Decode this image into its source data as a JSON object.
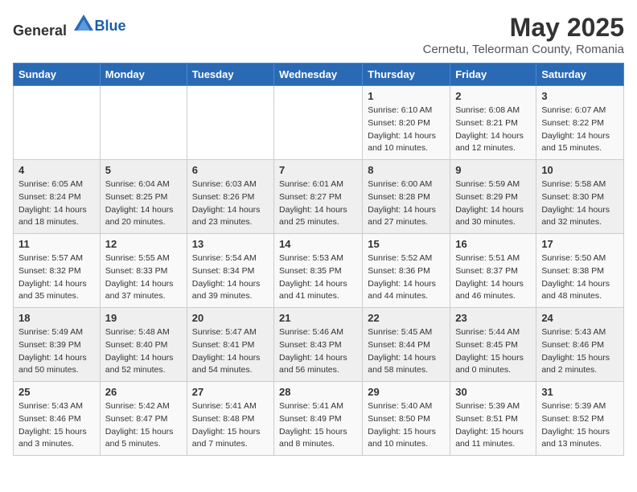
{
  "header": {
    "logo_general": "General",
    "logo_blue": "Blue",
    "month": "May 2025",
    "location": "Cernetu, Teleorman County, Romania"
  },
  "days_of_week": [
    "Sunday",
    "Monday",
    "Tuesday",
    "Wednesday",
    "Thursday",
    "Friday",
    "Saturday"
  ],
  "weeks": [
    [
      {
        "day": "",
        "info": ""
      },
      {
        "day": "",
        "info": ""
      },
      {
        "day": "",
        "info": ""
      },
      {
        "day": "",
        "info": ""
      },
      {
        "day": "1",
        "info": "Sunrise: 6:10 AM\nSunset: 8:20 PM\nDaylight: 14 hours\nand 10 minutes."
      },
      {
        "day": "2",
        "info": "Sunrise: 6:08 AM\nSunset: 8:21 PM\nDaylight: 14 hours\nand 12 minutes."
      },
      {
        "day": "3",
        "info": "Sunrise: 6:07 AM\nSunset: 8:22 PM\nDaylight: 14 hours\nand 15 minutes."
      }
    ],
    [
      {
        "day": "4",
        "info": "Sunrise: 6:05 AM\nSunset: 8:24 PM\nDaylight: 14 hours\nand 18 minutes."
      },
      {
        "day": "5",
        "info": "Sunrise: 6:04 AM\nSunset: 8:25 PM\nDaylight: 14 hours\nand 20 minutes."
      },
      {
        "day": "6",
        "info": "Sunrise: 6:03 AM\nSunset: 8:26 PM\nDaylight: 14 hours\nand 23 minutes."
      },
      {
        "day": "7",
        "info": "Sunrise: 6:01 AM\nSunset: 8:27 PM\nDaylight: 14 hours\nand 25 minutes."
      },
      {
        "day": "8",
        "info": "Sunrise: 6:00 AM\nSunset: 8:28 PM\nDaylight: 14 hours\nand 27 minutes."
      },
      {
        "day": "9",
        "info": "Sunrise: 5:59 AM\nSunset: 8:29 PM\nDaylight: 14 hours\nand 30 minutes."
      },
      {
        "day": "10",
        "info": "Sunrise: 5:58 AM\nSunset: 8:30 PM\nDaylight: 14 hours\nand 32 minutes."
      }
    ],
    [
      {
        "day": "11",
        "info": "Sunrise: 5:57 AM\nSunset: 8:32 PM\nDaylight: 14 hours\nand 35 minutes."
      },
      {
        "day": "12",
        "info": "Sunrise: 5:55 AM\nSunset: 8:33 PM\nDaylight: 14 hours\nand 37 minutes."
      },
      {
        "day": "13",
        "info": "Sunrise: 5:54 AM\nSunset: 8:34 PM\nDaylight: 14 hours\nand 39 minutes."
      },
      {
        "day": "14",
        "info": "Sunrise: 5:53 AM\nSunset: 8:35 PM\nDaylight: 14 hours\nand 41 minutes."
      },
      {
        "day": "15",
        "info": "Sunrise: 5:52 AM\nSunset: 8:36 PM\nDaylight: 14 hours\nand 44 minutes."
      },
      {
        "day": "16",
        "info": "Sunrise: 5:51 AM\nSunset: 8:37 PM\nDaylight: 14 hours\nand 46 minutes."
      },
      {
        "day": "17",
        "info": "Sunrise: 5:50 AM\nSunset: 8:38 PM\nDaylight: 14 hours\nand 48 minutes."
      }
    ],
    [
      {
        "day": "18",
        "info": "Sunrise: 5:49 AM\nSunset: 8:39 PM\nDaylight: 14 hours\nand 50 minutes."
      },
      {
        "day": "19",
        "info": "Sunrise: 5:48 AM\nSunset: 8:40 PM\nDaylight: 14 hours\nand 52 minutes."
      },
      {
        "day": "20",
        "info": "Sunrise: 5:47 AM\nSunset: 8:41 PM\nDaylight: 14 hours\nand 54 minutes."
      },
      {
        "day": "21",
        "info": "Sunrise: 5:46 AM\nSunset: 8:43 PM\nDaylight: 14 hours\nand 56 minutes."
      },
      {
        "day": "22",
        "info": "Sunrise: 5:45 AM\nSunset: 8:44 PM\nDaylight: 14 hours\nand 58 minutes."
      },
      {
        "day": "23",
        "info": "Sunrise: 5:44 AM\nSunset: 8:45 PM\nDaylight: 15 hours\nand 0 minutes."
      },
      {
        "day": "24",
        "info": "Sunrise: 5:43 AM\nSunset: 8:46 PM\nDaylight: 15 hours\nand 2 minutes."
      }
    ],
    [
      {
        "day": "25",
        "info": "Sunrise: 5:43 AM\nSunset: 8:46 PM\nDaylight: 15 hours\nand 3 minutes."
      },
      {
        "day": "26",
        "info": "Sunrise: 5:42 AM\nSunset: 8:47 PM\nDaylight: 15 hours\nand 5 minutes."
      },
      {
        "day": "27",
        "info": "Sunrise: 5:41 AM\nSunset: 8:48 PM\nDaylight: 15 hours\nand 7 minutes."
      },
      {
        "day": "28",
        "info": "Sunrise: 5:41 AM\nSunset: 8:49 PM\nDaylight: 15 hours\nand 8 minutes."
      },
      {
        "day": "29",
        "info": "Sunrise: 5:40 AM\nSunset: 8:50 PM\nDaylight: 15 hours\nand 10 minutes."
      },
      {
        "day": "30",
        "info": "Sunrise: 5:39 AM\nSunset: 8:51 PM\nDaylight: 15 hours\nand 11 minutes."
      },
      {
        "day": "31",
        "info": "Sunrise: 5:39 AM\nSunset: 8:52 PM\nDaylight: 15 hours\nand 13 minutes."
      }
    ]
  ]
}
